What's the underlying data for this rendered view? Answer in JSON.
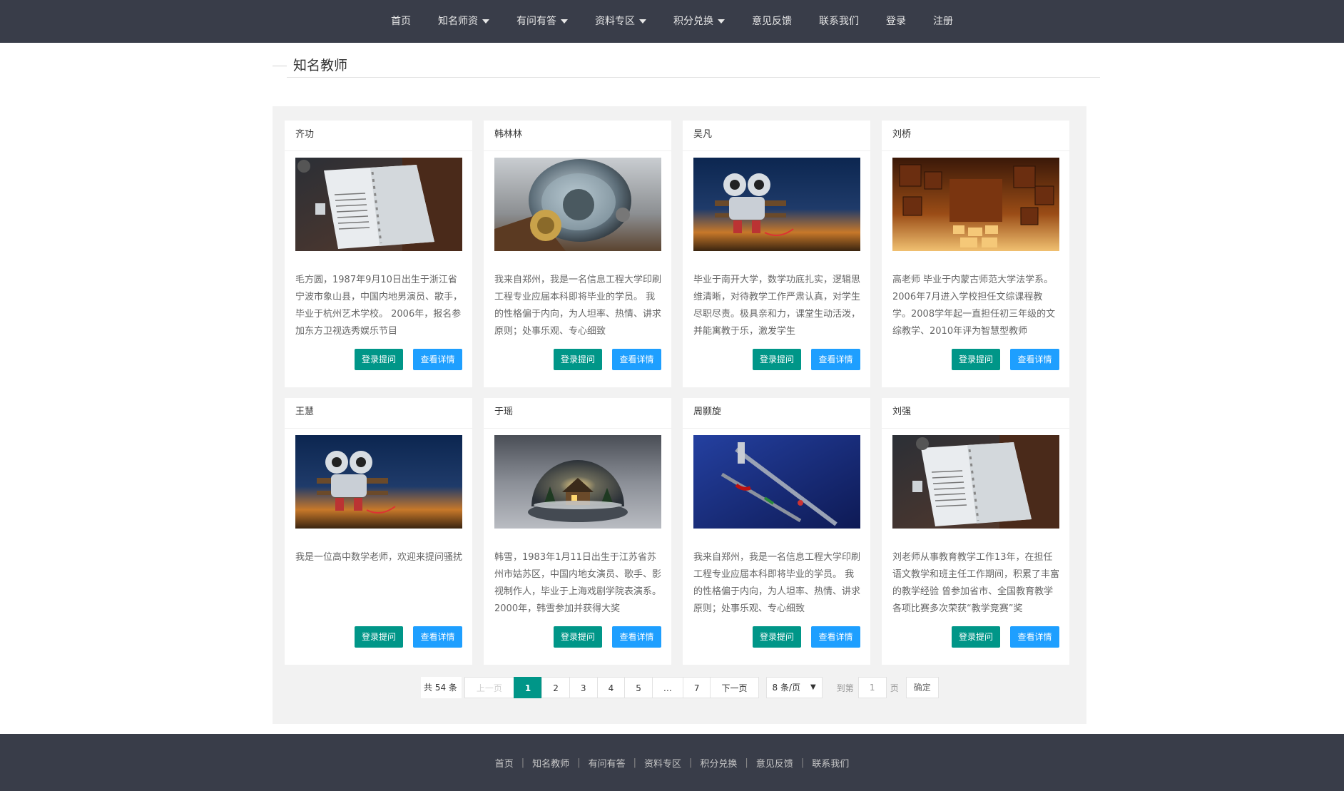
{
  "nav": {
    "items": [
      {
        "label": "首页",
        "dropdown": false
      },
      {
        "label": "知名师资",
        "dropdown": true
      },
      {
        "label": "有问有答",
        "dropdown": true
      },
      {
        "label": "资料专区",
        "dropdown": true
      },
      {
        "label": "积分兑换",
        "dropdown": true
      },
      {
        "label": "意见反馈",
        "dropdown": false
      },
      {
        "label": "联系我们",
        "dropdown": false
      },
      {
        "label": "登录",
        "dropdown": false
      },
      {
        "label": "注册",
        "dropdown": false
      }
    ]
  },
  "section": {
    "title": "知名教师"
  },
  "cards": [
    {
      "name": "齐功",
      "image": "notebook",
      "desc": "毛方圆，1987年9月10日出生于浙江省宁波市象山县，中国内地男演员、歌手，毕业于杭州艺术学校。 2006年，报名参加东方卫视选秀娱乐节目",
      "ask_label": "登录提问",
      "detail_label": "查看详情"
    },
    {
      "name": "韩林林",
      "image": "diver",
      "desc": "我来自郑州，我是一名信息工程大学印刷工程专业应届本科即将毕业的学员。 我的性格偏于内向，为人坦率、热情、讲求原则；处事乐观、专心细致",
      "ask_label": "登录提问",
      "detail_label": "查看详情"
    },
    {
      "name": "吴凡",
      "image": "robots",
      "desc": "毕业于南开大学，数学功底扎实，逻辑思维清晰，对待教学工作严肃认真，对学生尽职尽责。极具亲和力，课堂生动活泼，并能寓教于乐，激发学生",
      "ask_label": "登录提问",
      "detail_label": "查看详情"
    },
    {
      "name": "刘桥",
      "image": "cubes",
      "desc": "高老师 毕业于内蒙古师范大学法学系。2006年7月进入学校担任文综课程教学。2008学年起一直担任初三年级的文综教学、2010年评为智慧型教师",
      "ask_label": "登录提问",
      "detail_label": "查看详情"
    },
    {
      "name": "王慧",
      "image": "robots",
      "desc": "我是一位高中数学老师，欢迎来提问骚扰",
      "ask_label": "登录提问",
      "detail_label": "查看详情"
    },
    {
      "name": "于瑶",
      "image": "snowglobe",
      "desc": "韩雪，1983年1月11日出生于江苏省苏州市姑苏区，中国内地女演员、歌手、影视制作人，毕业于上海戏剧学院表演系。2000年，韩雪参加并获得大奖",
      "ask_label": "登录提问",
      "detail_label": "查看详情"
    },
    {
      "name": "周颢旋",
      "image": "syringe",
      "desc": "我来自郑州，我是一名信息工程大学印刷工程专业应届本科即将毕业的学员。 我的性格偏于内向，为人坦率、热情、讲求原则；处事乐观、专心细致",
      "ask_label": "登录提问",
      "detail_label": "查看详情"
    },
    {
      "name": "刘强",
      "image": "notebook",
      "desc": "刘老师从事教育教学工作13年，在担任语文教学和班主任工作期间，积累了丰富的教学经验 曾参加省市、全国教育教学各项比赛多次荣获“教学竞赛”奖",
      "ask_label": "登录提问",
      "detail_label": "查看详情"
    }
  ],
  "pager": {
    "count": "共 54 条",
    "prev": "上一页",
    "pages": [
      "1",
      "2",
      "3",
      "4",
      "5",
      "…",
      "7"
    ],
    "current": "1",
    "next": "下一页",
    "limit": "8 条/页",
    "skip_to": "到第",
    "skip_value": "1",
    "page_unit": "页",
    "confirm": "确定"
  },
  "footer": {
    "links": [
      "首页",
      "知名教师",
      "有问有答",
      "资料专区",
      "积分兑换",
      "意见反馈",
      "联系我们"
    ],
    "separator": "|"
  },
  "colors": {
    "nav_bg": "#393d49",
    "ask_button": "#009688",
    "detail_button": "#1e9fff",
    "panel_bg": "#f2f2f2"
  }
}
